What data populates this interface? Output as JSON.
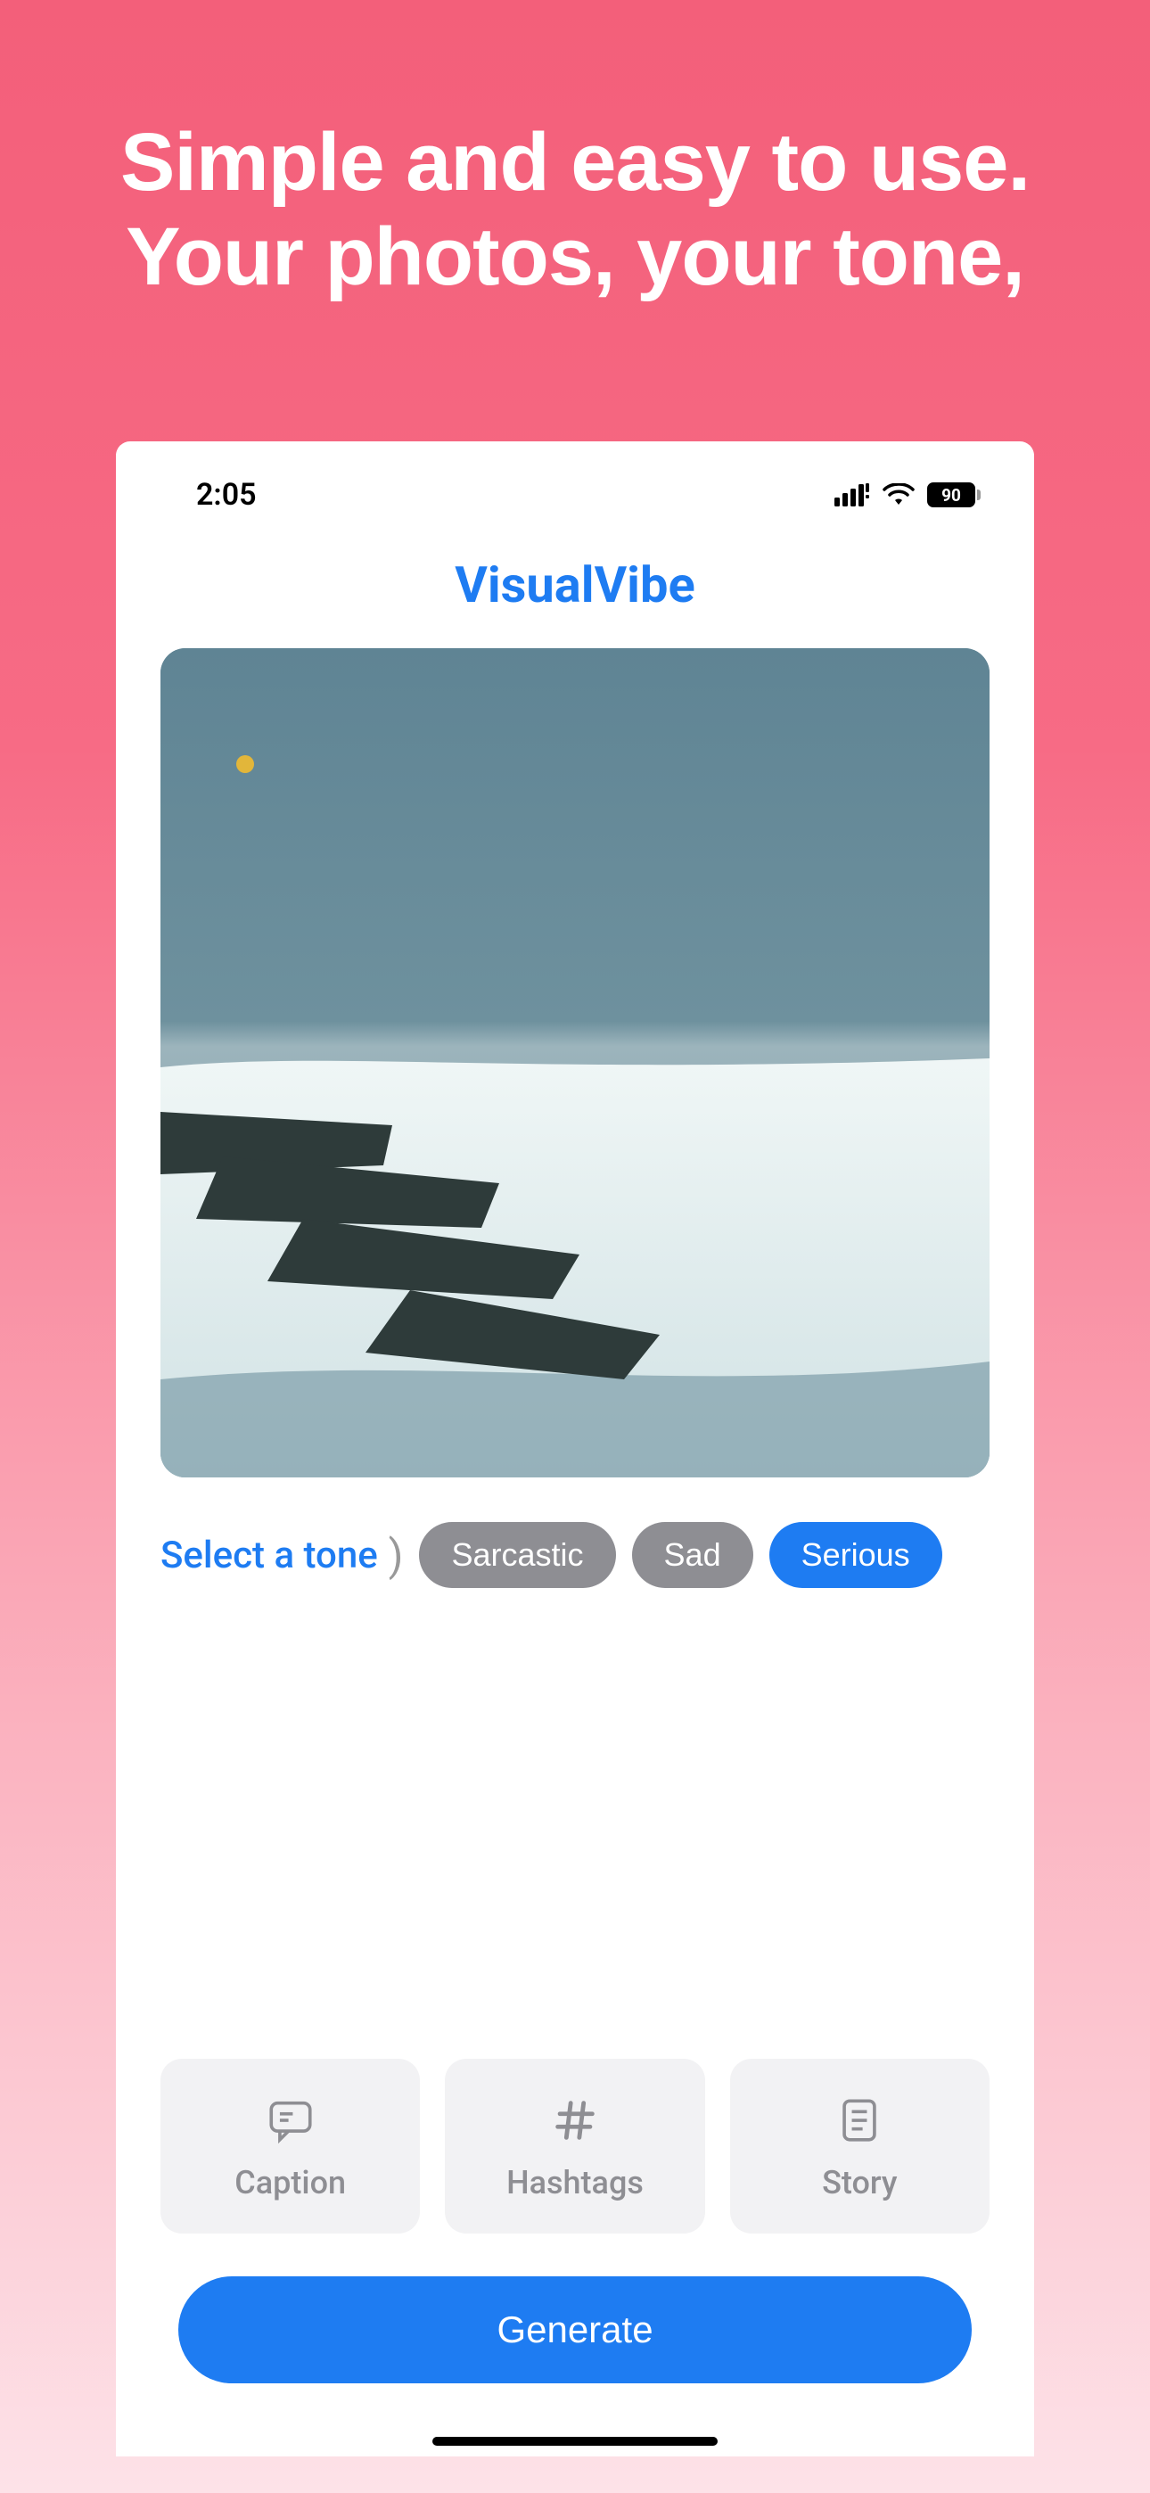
{
  "promo": {
    "headline": "Simple and easy to use. Your photos, your tone,"
  },
  "status": {
    "time": "2:05",
    "battery": "90"
  },
  "app": {
    "title": "VisualVibe"
  },
  "tone": {
    "label": "Select a tone",
    "chips": [
      "Sarcastic",
      "Sad",
      "Serious"
    ],
    "selected": "Serious"
  },
  "options": {
    "caption": "Caption",
    "hashtags": "Hashtags",
    "story": "Story"
  },
  "actions": {
    "generate": "Generate"
  }
}
